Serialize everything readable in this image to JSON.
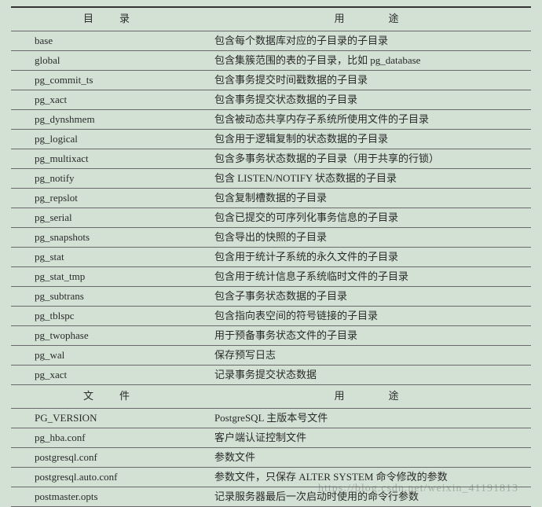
{
  "headers": {
    "dir_col": "目　录",
    "use_col": "用　　途",
    "file_col": "文　件",
    "use_col2": "用　　途"
  },
  "dir_rows": [
    {
      "name": "base",
      "desc": "包含每个数据库对应的子目录的子目录"
    },
    {
      "name": "global",
      "desc": "包含集簇范围的表的子目录，比如 pg_database"
    },
    {
      "name": "pg_commit_ts",
      "desc": "包含事务提交时间戳数据的子目录"
    },
    {
      "name": "pg_xact",
      "desc": "包含事务提交状态数据的子目录"
    },
    {
      "name": "pg_dynshmem",
      "desc": "包含被动态共享内存子系统所使用文件的子目录"
    },
    {
      "name": "pg_logical",
      "desc": "包含用于逻辑复制的状态数据的子目录"
    },
    {
      "name": "pg_multixact",
      "desc": "包含多事务状态数据的子目录（用于共享的行锁）"
    },
    {
      "name": "pg_notify",
      "desc": "包含 LISTEN/NOTIFY 状态数据的子目录"
    },
    {
      "name": "pg_repslot",
      "desc": "包含复制槽数据的子目录"
    },
    {
      "name": "pg_serial",
      "desc": "包含已提交的可序列化事务信息的子目录"
    },
    {
      "name": "pg_snapshots",
      "desc": "包含导出的快照的子目录"
    },
    {
      "name": "pg_stat",
      "desc": "包含用于统计子系统的永久文件的子目录"
    },
    {
      "name": "pg_stat_tmp",
      "desc": "包含用于统计信息子系统临时文件的子目录"
    },
    {
      "name": "pg_subtrans",
      "desc": "包含子事务状态数据的子目录"
    },
    {
      "name": "pg_tblspc",
      "desc": "包含指向表空间的符号链接的子目录"
    },
    {
      "name": "pg_twophase",
      "desc": "用于预备事务状态文件的子目录"
    },
    {
      "name": "pg_wal",
      "desc": "保存预写日志"
    },
    {
      "name": "pg_xact",
      "desc": "记录事务提交状态数据"
    }
  ],
  "file_rows": [
    {
      "name": "PG_VERSION",
      "desc": "PostgreSQL 主版本号文件"
    },
    {
      "name": "pg_hba.conf",
      "desc": "客户端认证控制文件"
    },
    {
      "name": "postgresql.conf",
      "desc": "参数文件"
    },
    {
      "name": "postgresql.auto.conf",
      "desc": "参数文件，只保存 ALTER SYSTEM 命令修改的参数"
    },
    {
      "name": "postmaster.opts",
      "desc": "记录服务器最后一次启动时使用的命令行参数"
    }
  ],
  "watermark": "https://blog.csdn.net/weixin_41191813"
}
